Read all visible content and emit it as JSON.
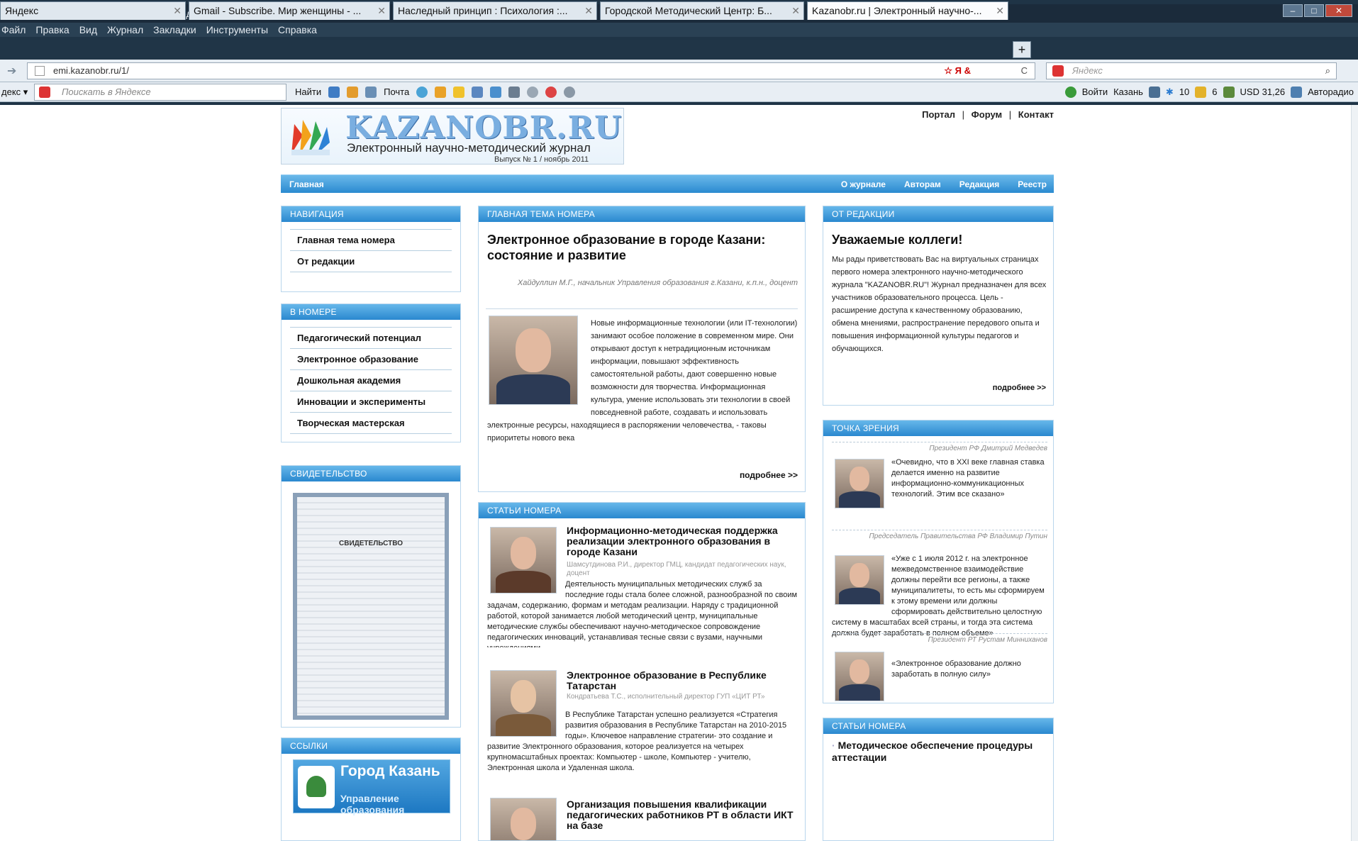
{
  "browser": {
    "title": "Kazanobr.ru | Электронный научно-методический журнал - Mozilla Firefox",
    "menu": [
      "Файл",
      "Правка",
      "Вид",
      "Журнал",
      "Закладки",
      "Инструменты",
      "Справка"
    ],
    "tabs": [
      {
        "label": "Яндекс"
      },
      {
        "label": "Gmail - Subscribe. Мир женщины - ..."
      },
      {
        "label": "Наследный принцип : Психология :..."
      },
      {
        "label": "Городской Методический Центр: Б..."
      },
      {
        "label": "Kazanobr.ru | Электронный научно-..."
      }
    ],
    "url": "emi.kazanobr.ru/1/",
    "search_placeholder": "Яндекс",
    "yandex_placeholder": "Поискать в Яндексе",
    "find_label": "Найти",
    "mail_label": "Почта",
    "login_label": "Войти",
    "city": "Казань",
    "temp": "10",
    "score": "6",
    "usd": "USD 31,26",
    "autoradio": "Авторадио"
  },
  "site": {
    "logo_title": "KAZANOBR.RU",
    "logo_subtitle": "Электронный научно-методический журнал",
    "logo_issue": "Выпуск № 1 / ноябрь 2011",
    "toplinks": {
      "portal": "Портал",
      "forum": "Форум",
      "contact": "Контакт",
      "sep": "|"
    },
    "nav": {
      "home": "Главная",
      "about": "О журнале",
      "authors": "Авторам",
      "editorial": "Редакция",
      "registry": "Реестр"
    },
    "navigation": {
      "title": "НАВИГАЦИЯ",
      "items": [
        "Главная тема номера",
        "От редакции"
      ]
    },
    "in_issue": {
      "title": "В НОМЕРЕ",
      "items": [
        "Педагогический потенциал",
        "Электронное образование",
        "Дошкольная академия",
        "Инновации и эксперименты",
        "Творческая мастерская"
      ]
    },
    "certificate": {
      "title": "СВИДЕТЕЛЬСТВО",
      "doc_heading": "СВИДЕТЕЛЬСТВО"
    },
    "links": {
      "title": "ССЫЛКИ",
      "banner_title": "Город Казань",
      "banner_sub": "Управление образования"
    },
    "main_topic": {
      "header": "ГЛАВНАЯ ТЕМА НОМЕРА",
      "title": "Электронное образование в городе Казани: состояние и развитие",
      "byline": "Хайдуллин М.Г., начальник Управления образования г.Казани, к.п.н., доцент",
      "body": "Новые информационные технологии (или IT-технологии) занимают особое положение в современном мире. Они открывают доступ к нетрадиционным источникам информации, повышают эффективность самостоятельной работы, дают совершенно новые возможности для творчества. Информационная культура, умение использовать эти технологии в своей повседневной работе, создавать и использовать электронные ресурсы, находящиеся в распоряжении человечества, - таковы приоритеты нового века",
      "more": "подробнее >>"
    },
    "articles": {
      "header": "СТАТЬИ НОМЕРА",
      "items": [
        {
          "title": "Информационно-методическая поддержка реализации электронного образования в городе Казани",
          "meta": "Шамсутдинова Р.И., директор ГМЦ, кандидат педагогических наук, доцент",
          "body": "Деятельность муниципальных методических служб за последние годы стала более сложной, разнообразной по своим задачам, содержанию, формам и методам реализации. Наряду с традиционной работой, которой занимается любой методический центр, муниципальные методические службы обеспечивают научно-методическое сопровождение педагогических инноваций, устанавливая тесные связи с вузами, научными учреждениями."
        },
        {
          "title": "Электронное образование в Республике Татарстан",
          "meta": "Кондратьева Т.С., исполнительный директор ГУП «ЦИТ РТ»",
          "body": "В Республике Татарстан успешно реализуется «Стратегия развития образования в Республике Татарстан на 2010-2015 годы». Ключевое направление стратегии- это создание и развитие Электронного образования, которое реализуется на четырех крупномасштабных проектах: Компьютер - школе, Компьютер - учителю, Электронная школа и Удаленная школа."
        },
        {
          "title": "Организация повышения квалификации педагогических работников РТ в области ИКТ на базе",
          "meta": "",
          "body": ""
        }
      ]
    },
    "editorial": {
      "header": "ОТ РЕДАКЦИИ",
      "title": "Уважаемые коллеги!",
      "body": "Мы рады приветствовать Вас на виртуальных страницах первого номера электронного научно-методического журнала \"KAZANOBR.RU\"! Журнал предназначен для всех участников образовательного процесса. Цель - расширение доступа к качественному образованию, обмена мнениями, распространение передового опыта и повышения информационной культуры педагогов и обучающихся.",
      "more": "подробнее >>"
    },
    "viewpoint": {
      "header": "ТОЧКА ЗРЕНИЯ",
      "items": [
        {
          "by": "Президент РФ Дмитрий Медведев",
          "quote": "«Очевидно, что в XXI веке главная ставка делается именно на развитие информационно-коммуникационных технологий. Этим все сказано»"
        },
        {
          "by": "Председатель Правительства РФ Владимир Путин",
          "quote": "«Уже с 1 июля 2012 г. на электронное межведомственное взаимодействие должны перейти все регионы, а также муниципалитеты, то есть мы сформируем к этому времени или должны сформировать действительно целостную систему в масштабах всей страны, и тогда эта система должна будет заработать в полном объеме»"
        },
        {
          "by": "Президент РТ Рустам Минниханов",
          "quote": "«Электронное образование должно заработать в полную силу»"
        }
      ]
    },
    "right_articles": {
      "header": "СТАТЬИ НОМЕРА",
      "first": "Методическое обеспечение процедуры аттестации"
    }
  }
}
